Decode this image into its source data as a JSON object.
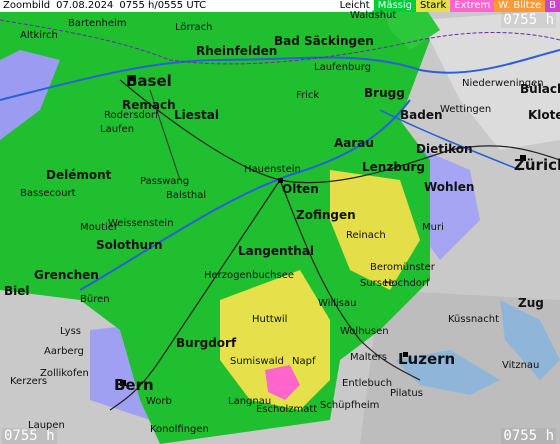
{
  "header": {
    "title": "Zoombild",
    "date": "07.08.2024",
    "time": "0755 h/0555 UTC",
    "legend": [
      {
        "label": "Leicht",
        "color": "#ffffff"
      },
      {
        "label": "Mässig",
        "color": "#00cc33"
      },
      {
        "label": "Stark",
        "color": "#e6e04a"
      },
      {
        "label": "Extrem",
        "color": "#ff66cc"
      },
      {
        "label": "W. Blitze",
        "color": "#ff9933"
      },
      {
        "label": "B",
        "color": "#cc44cc"
      }
    ]
  },
  "timestamps": {
    "top_right": "0755 h",
    "bottom_left": "0755 h",
    "bottom_right": "0755 h"
  },
  "place_labels": {
    "bartenheim": "Bartenheim",
    "altkirch": "Altkirch",
    "lorrach": "Lörrach",
    "rheinfelden": "Rheinfelden",
    "bad_sackingen": "Bad Säckingen",
    "laufenburg": "Laufenburg",
    "waldshut": "Waldshut",
    "basel": "Basel",
    "remach": "Remach",
    "liestal": "Liestal",
    "rodersdorf": "Rodersdorf",
    "laufen": "Laufen",
    "frick": "Frick",
    "brugg": "Brugg",
    "baden": "Baden",
    "wettingen": "Wettingen",
    "niederweningen": "Niederweningen",
    "bulach": "Bülach",
    "kloten": "Kloten",
    "aarau": "Aarau",
    "dietikon": "Dietikon",
    "zurich": "Zürich",
    "delemont": "Delémont",
    "passwang": "Passwang",
    "olten": "Olten",
    "lenzburg": "Lenzburg",
    "wohlen": "Wohlen",
    "zofingen": "Zofingen",
    "bassecourt": "Bassecourt",
    "moutier": "Moutier",
    "solothurn": "Solothurn",
    "langenthal": "Langenthal",
    "sursee": "Sursee",
    "grenchen": "Grenchen",
    "biel": "Biel",
    "herzogenbuchsee": "Herzogenbuchsee",
    "willisau": "Willisau",
    "buren": "Büren",
    "huttwil": "Huttwil",
    "wolhusen": "Wolhusen",
    "lyss": "Lyss",
    "burgdorf": "Burgdorf",
    "sumiswald": "Sumiswald",
    "napf": "Napf",
    "luzern": "Luzern",
    "zollikofen": "Zollikofen",
    "bern": "Bern",
    "entlebuch": "Entlebuch",
    "pilatus": "Pilatus",
    "escholzmatt": "Escholzmatt",
    "worb": "Worb",
    "konolfingen": "Konolfingen",
    "schupfheim": "Schüpfheim",
    "langnau": "Langnau",
    "weissenstein": "Weissenstein",
    "balsthal": "Balsthal",
    "hauenstein": "Hauenstein",
    "muri": "Muri",
    "reinach": "Reinach",
    "beromunster": "Beromünster",
    "hochdorf": "Hochdorf",
    "kussnacht": "Küssnacht",
    "zug": "Zug",
    "vitznau": "Vitznau",
    "malters": "Malters",
    "laupen": "Laupen",
    "kerzers": "Kerzers",
    "aarberg": "Aarberg"
  }
}
